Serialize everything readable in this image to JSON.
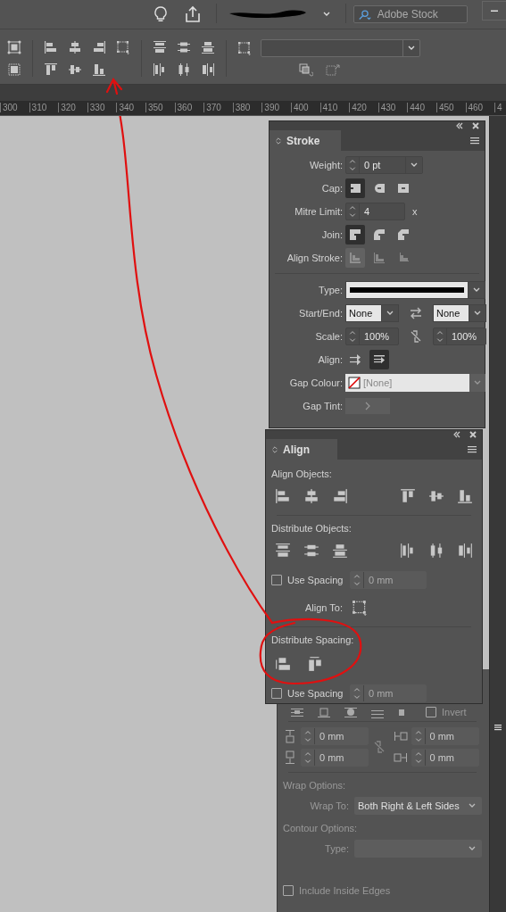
{
  "app_bar": {
    "search_placeholder": "Adobe Stock"
  },
  "ruler": {
    "labels": [
      "300",
      "310",
      "320",
      "330",
      "340",
      "350",
      "360",
      "370",
      "380",
      "390",
      "400",
      "410",
      "420",
      "430",
      "440",
      "450",
      "460",
      "4"
    ]
  },
  "stroke_panel": {
    "title": "Stroke",
    "weight": {
      "label": "Weight:",
      "value": "0 pt"
    },
    "cap": {
      "label": "Cap:",
      "options": [
        {
          "kind": "butt",
          "selected": true
        },
        {
          "kind": "round",
          "selected": false
        },
        {
          "kind": "projecting",
          "selected": false
        }
      ]
    },
    "mitre_limit": {
      "label": "Mitre Limit:",
      "value": "4",
      "unit": "x"
    },
    "join": {
      "label": "Join:",
      "options": [
        {
          "kind": "miter",
          "selected": true
        },
        {
          "kind": "round",
          "selected": false
        },
        {
          "kind": "bevel",
          "selected": false
        }
      ]
    },
    "align_stroke": {
      "label": "Align Stroke:",
      "disabled": true,
      "options": [
        {
          "kind": "center",
          "selected": true
        },
        {
          "kind": "inside",
          "selected": false
        },
        {
          "kind": "outside",
          "selected": false
        }
      ]
    },
    "type": {
      "label": "Type:"
    },
    "start_end": {
      "label": "Start/End:",
      "start": "None",
      "end": "None"
    },
    "scale": {
      "label": "Scale:",
      "start": "100%",
      "end": "100%"
    },
    "align": {
      "label": "Align:",
      "options": [
        {
          "kind": "center",
          "selected": false
        },
        {
          "kind": "inside",
          "selected": true
        }
      ]
    },
    "gap_colour": {
      "label": "Gap Colour:",
      "value": "[None]"
    },
    "gap_tint": {
      "label": "Gap Tint:"
    }
  },
  "align_panel": {
    "title": "Align",
    "align_objects": "Align Objects:",
    "distribute_objects": "Distribute Objects:",
    "use_spacing_1": {
      "label": "Use Spacing",
      "checked": false,
      "value": "0 mm"
    },
    "align_to": "Align To:",
    "distribute_spacing": "Distribute Spacing:",
    "use_spacing_2": {
      "label": "Use Spacing",
      "checked": false,
      "value": "0 mm"
    }
  },
  "wrap_panel": {
    "invert": {
      "label": "Invert",
      "checked": false
    },
    "offsets": [
      "0 mm",
      "0 mm",
      "0 mm",
      "0 mm"
    ],
    "wrap_options": "Wrap Options:",
    "wrap_to": {
      "label": "Wrap To:",
      "value": "Both Right & Left Sides"
    },
    "contour_options": "Contour Options:",
    "type_label": "Type:",
    "include_inside_edges": {
      "label": "Include Inside Edges",
      "checked": false
    }
  }
}
